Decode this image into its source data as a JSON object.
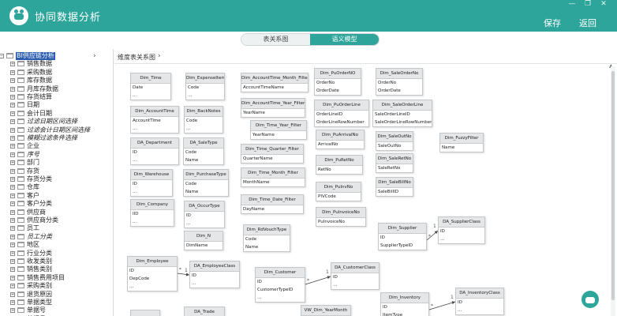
{
  "app": {
    "title": "协同数据分析",
    "save": "保存",
    "back": "返回"
  },
  "window_controls": {
    "minimize": "—",
    "maximize": "❐",
    "close": "✕"
  },
  "tabs": [
    {
      "label": "表关系图",
      "active": false
    },
    {
      "label": "语义模型",
      "active": true
    }
  ],
  "breadcrumb": "维度表关系图",
  "tree": [
    {
      "label": "BI供应链分析",
      "exp": "−",
      "sel": true
    },
    {
      "label": "销售数据",
      "exp": "+"
    },
    {
      "label": "采购数据",
      "exp": "+"
    },
    {
      "label": "库存数据",
      "exp": "+"
    },
    {
      "label": "月库存数据",
      "exp": "+"
    },
    {
      "label": "存货结算",
      "exp": "+"
    },
    {
      "label": "日期",
      "exp": "+"
    },
    {
      "label": "会计日期",
      "exp": "+"
    },
    {
      "label": "过滤日期区间选择",
      "exp": "+",
      "it": true
    },
    {
      "label": "过滤会计日期区间选择",
      "exp": "+",
      "it": true
    },
    {
      "label": "模糊过滤条件选择",
      "exp": "+",
      "it": true
    },
    {
      "label": "企业",
      "exp": "+"
    },
    {
      "label": "序号",
      "exp": "+",
      "it": true
    },
    {
      "label": "部门",
      "exp": "+"
    },
    {
      "label": "存货",
      "exp": "+"
    },
    {
      "label": "存货分类",
      "exp": "+"
    },
    {
      "label": "仓库",
      "exp": "+"
    },
    {
      "label": "客户",
      "exp": "+"
    },
    {
      "label": "客户分类",
      "exp": "+"
    },
    {
      "label": "供应商",
      "exp": "+"
    },
    {
      "label": "供应商分类",
      "exp": "+"
    },
    {
      "label": "员工",
      "exp": "+"
    },
    {
      "label": "员工分类",
      "exp": "+",
      "it": true
    },
    {
      "label": "地区",
      "exp": "+"
    },
    {
      "label": "行业分类",
      "exp": "+"
    },
    {
      "label": "收发类别",
      "exp": "+"
    },
    {
      "label": "销售类别",
      "exp": "+"
    },
    {
      "label": "销售费用项目",
      "exp": "+"
    },
    {
      "label": "采购类别",
      "exp": "+"
    },
    {
      "label": "退货原因",
      "exp": "+"
    },
    {
      "label": "单据类型",
      "exp": "+"
    },
    {
      "label": "单据号",
      "exp": "+"
    },
    {
      "label": "单据号",
      "exp": "+"
    }
  ],
  "tables": [
    {
      "name": "Dim_Time",
      "fields": [
        "Date",
        "..."
      ]
    },
    {
      "name": "Dim_ExpenseItem",
      "fields": [
        "Code",
        "..."
      ]
    },
    {
      "name": "Dim_AccountTime_Month_Filter",
      "fields": [
        "AccountTimeName"
      ]
    },
    {
      "name": "Dim_PuOrderNO",
      "fields": [
        "OrderNo",
        "OrderDate"
      ]
    },
    {
      "name": "Dim_SaleOrderNo",
      "fields": [
        "OrderNo",
        "OrderDate"
      ]
    },
    {
      "name": "Dim_AccountTime",
      "fields": [
        "AccountTime",
        "..."
      ]
    },
    {
      "name": "Dim_BackNotes",
      "fields": [
        "Code",
        "..."
      ]
    },
    {
      "name": "Dim_AccountTime_Year_Filter",
      "fields": [
        "YearName"
      ]
    },
    {
      "name": "Dim_PuOrderLine",
      "fields": [
        "OrderLineID",
        "OrderLineRowNumber"
      ]
    },
    {
      "name": "Dim_SaleOrderLine",
      "fields": [
        "SaleOrderLineID",
        "SaleOrderLineRowNumber"
      ]
    },
    {
      "name": "Dim_Time_Year_Filter",
      "fields": [
        "YearName"
      ]
    },
    {
      "name": "DA_Department",
      "fields": [
        "ID",
        "..."
      ]
    },
    {
      "name": "DA_SaleType",
      "fields": [
        "Code",
        "Name"
      ]
    },
    {
      "name": "Dim_PuArrivalNo",
      "fields": [
        "ArrivalNo"
      ]
    },
    {
      "name": "Dim_SaleOutNo",
      "fields": [
        "SaleOutNo"
      ]
    },
    {
      "name": "Dim_FuzzyFilter",
      "fields": [
        "Name"
      ]
    },
    {
      "name": "Dim_Time_Quarter_Filter",
      "fields": [
        "QuarterName"
      ]
    },
    {
      "name": "Dim_PuRetNo",
      "fields": [
        "RetNo"
      ]
    },
    {
      "name": "Dim_SaleRetNo",
      "fields": [
        "SaleRetNo"
      ]
    },
    {
      "name": "Dim_Warehouse",
      "fields": [
        "ID",
        "..."
      ]
    },
    {
      "name": "Dim_PurchaseType",
      "fields": [
        "Code",
        "Name"
      ]
    },
    {
      "name": "Dim_Time_Month_Filter",
      "fields": [
        "MonthName"
      ]
    },
    {
      "name": "Dim_SaleBillNo",
      "fields": [
        "SaleBillID"
      ]
    },
    {
      "name": "Dim_PuInvNo",
      "fields": [
        "PIVCode"
      ]
    },
    {
      "name": "Dim_Time_Date_Filter",
      "fields": [
        "DayName"
      ]
    },
    {
      "name": "Dim_Company",
      "fields": [
        "IID",
        "..."
      ]
    },
    {
      "name": "DA_OccurType",
      "fields": [
        "ID",
        "..."
      ]
    },
    {
      "name": "Dim_PuInvoiceNo",
      "fields": [
        "PuInvoiceNo"
      ]
    },
    {
      "name": "Dim_RdVouchType",
      "fields": [
        "Code",
        "Name"
      ]
    },
    {
      "name": "Dim_Supplier",
      "fields": [
        "ID",
        "SupplierTypeID"
      ]
    },
    {
      "name": "DA_SupplierClass",
      "fields": [
        "ID",
        "..."
      ]
    },
    {
      "name": "Dim_N",
      "fields": [
        "DimName"
      ]
    },
    {
      "name": "Dim_Employee",
      "fields": [
        "ID",
        "DepCode",
        "..."
      ]
    },
    {
      "name": "DA_EmployeeClass",
      "fields": [
        "ID",
        "..."
      ]
    },
    {
      "name": "Dim_Customer",
      "fields": [
        "ID",
        "CustomerTypeID",
        "..."
      ]
    },
    {
      "name": "DA_CustomerClass",
      "fields": [
        "ID",
        "..."
      ]
    },
    {
      "name": "Dim_Inventory",
      "fields": [
        "ID",
        "ItemType"
      ]
    },
    {
      "name": "DA_InventoryClass",
      "fields": [
        "ID",
        "..."
      ]
    },
    {
      "name": "DA_Trade",
      "fields": []
    },
    {
      "name": "VW_Dim_YearMonth",
      "fields": []
    },
    {
      "name": "",
      "fields": []
    }
  ],
  "relations": [
    {
      "from": "Dim_Supplier",
      "to": "DA_SupplierClass",
      "label_from": "*",
      "label_to": "1"
    },
    {
      "from": "Dim_Employee",
      "to": "DA_EmployeeClass",
      "label_from": "*",
      "label_to": "1"
    },
    {
      "from": "Dim_Customer",
      "to": "DA_CustomerClass",
      "label_from": "*",
      "label_to": "1"
    },
    {
      "from": "Dim_Inventory",
      "to": "DA_InventoryClass",
      "label_from": "*",
      "label_to": "1"
    }
  ]
}
